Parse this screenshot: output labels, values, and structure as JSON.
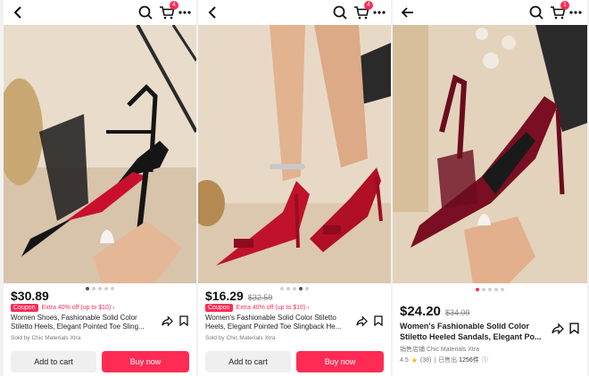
{
  "panels": [
    {
      "cart_badge": "4",
      "price": "$30.89",
      "original_price": "",
      "coupon_label": "Coupon",
      "coupon_text": "Extra 40% off (up to $10) ›",
      "title": "Women Shoes, Fashionable Solid Color Stiletto Heels, Elegant Pointed Toe Sling...",
      "seller": "Sold by Chic Materials Xtra",
      "add_to_cart": "Add to cart",
      "buy_now": "Buy now"
    },
    {
      "cart_badge": "4",
      "price": "$16.29",
      "original_price": "$32.59",
      "coupon_label": "Coupon",
      "coupon_text": "Extra 40% off (up to $10) ›",
      "title": "Women's Fashionable Solid Color Stiletto Heels, Elegant Pointed Toe Slingback He...",
      "seller": "Sold by Chic Materials Xtra",
      "add_to_cart": "Add to cart",
      "buy_now": "Buy now"
    },
    {
      "cart_badge": "1",
      "price": "$24.20",
      "original_price": "$34.09",
      "title": "Women's Fashionable Solid Color Stiletto Heeled Sandals, Elegant Po...",
      "seller": "销售店铺 Chic Materials Xtra",
      "rating": "4.5",
      "reviews": "(38)",
      "sold_prefix": "已售出",
      "sold_count": "1256件"
    }
  ],
  "icons": {
    "back": "chevron-left-icon",
    "search": "search-icon",
    "cart": "cart-icon",
    "more": "more-icon",
    "share": "share-icon",
    "save": "bookmark-icon"
  },
  "colors": {
    "accent": "#fe2c55",
    "shoe_black": "#151515",
    "shoe_red": "#c0122a",
    "shoe_burgundy": "#7a0e22"
  }
}
